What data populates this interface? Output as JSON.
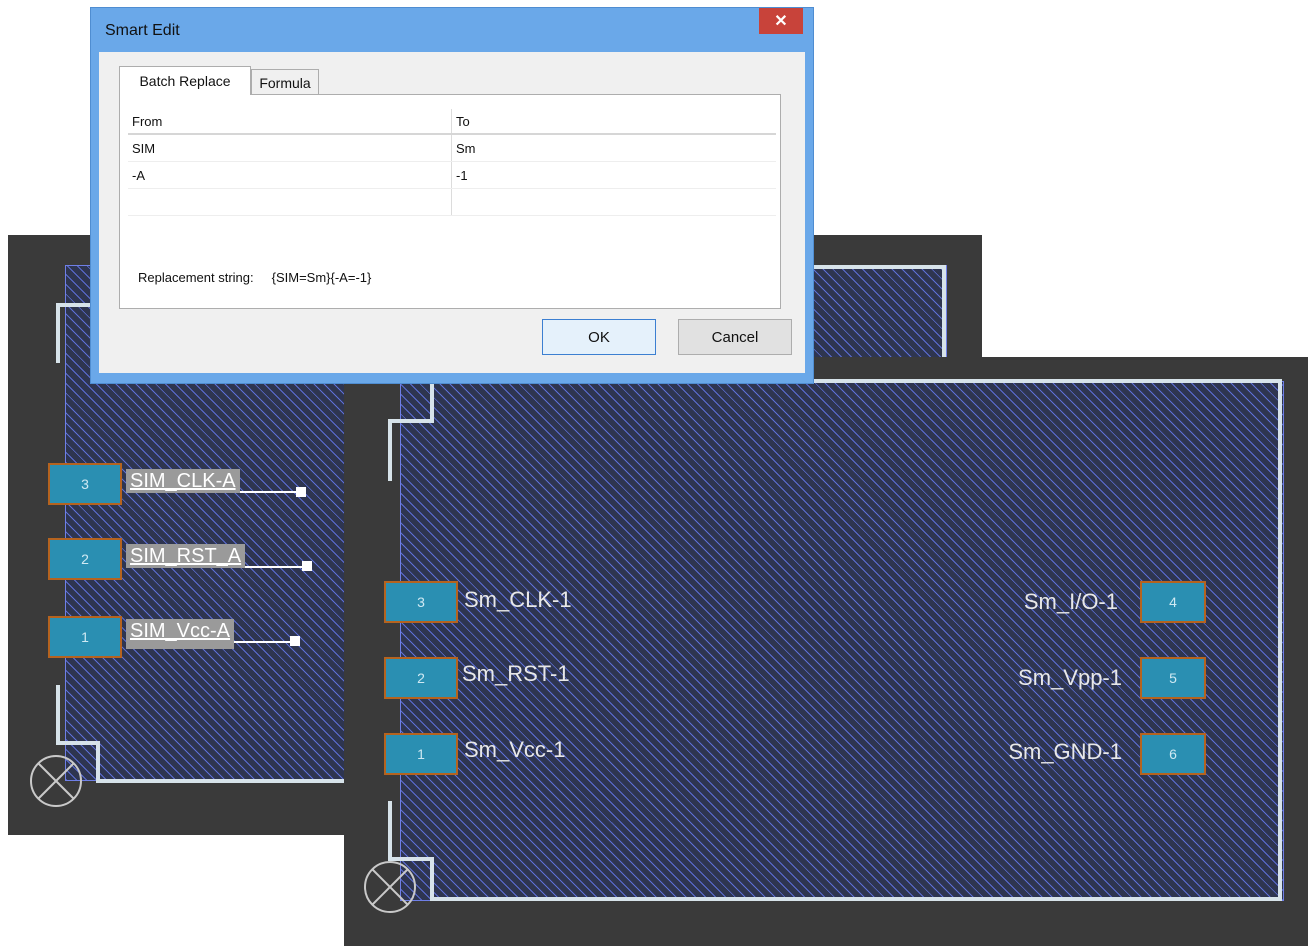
{
  "dialog": {
    "title": "Smart Edit",
    "close_label": "✕",
    "tabs": [
      {
        "label": "Batch Replace",
        "active": true
      },
      {
        "label": "Formula",
        "active": false
      }
    ],
    "columns": {
      "from": "From",
      "to": "To"
    },
    "rows": [
      {
        "from": "SIM",
        "to": "Sm"
      },
      {
        "from": "-A",
        "to": "-1"
      },
      {
        "from": "",
        "to": ""
      }
    ],
    "replacement_label": "Replacement string:",
    "replacement_value": "{SIM=Sm}{-A=-1}",
    "ok_label": "OK",
    "cancel_label": "Cancel"
  },
  "before_component": {
    "pins": [
      {
        "number": "3",
        "label": "SIM_CLK-A"
      },
      {
        "number": "2",
        "label": "SIM_RST_A"
      },
      {
        "number": "1",
        "label": "SIM_Vcc-A"
      }
    ]
  },
  "after_component": {
    "left_pins": [
      {
        "number": "3",
        "label": "Sm_CLK-1"
      },
      {
        "number": "2",
        "label": "Sm_RST-1"
      },
      {
        "number": "1",
        "label": "Sm_Vcc-1"
      }
    ],
    "right_pins": [
      {
        "number": "4",
        "label": "Sm_I/O-1"
      },
      {
        "number": "5",
        "label": "Sm_Vpp-1"
      },
      {
        "number": "6",
        "label": "Sm_GND-1"
      }
    ]
  },
  "colors": {
    "panel_bg": "#3a3a3a",
    "hatch": "#5d6fd6",
    "pin_fill": "#2a8fb2",
    "pin_border": "#b5631f",
    "outline": "#d7e3ea",
    "dialog_frame": "#6aa8e9",
    "close_button": "#c8433a"
  },
  "icons": {
    "origin_marker": "circle-x-icon"
  }
}
